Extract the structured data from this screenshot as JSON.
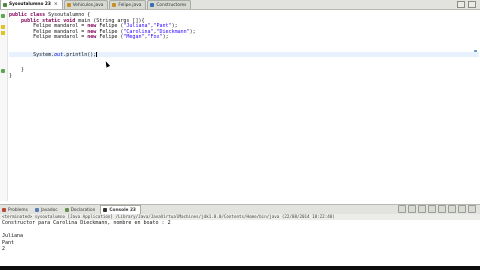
{
  "editor_tabs": [
    {
      "label": "Sysoutalumno 23",
      "active": true,
      "icon_color": "#4a8a3a"
    },
    {
      "label": "Vehiculos.java",
      "active": false,
      "icon_color": "#c78f2a"
    },
    {
      "label": "Felipe.java",
      "active": false,
      "icon_color": "#c78f2a"
    },
    {
      "label": "Constructores",
      "active": false,
      "icon_color": "#3a6fb0"
    }
  ],
  "editor": {
    "line_numbers": [
      "1",
      "2",
      "3",
      "4",
      "5",
      "6",
      "7",
      "8",
      "9",
      "10",
      "11",
      "12",
      "13"
    ],
    "lines": [
      "public class Sysoutalumno {",
      "    public static void main (String args []){",
      "        Felipe mandarol = new Felipe (\"Juliana\",\"Pant\");",
      "        Felipe mandarol = new Felipe (\"Carolina\",\"Dieckmann\");",
      "        Felipe mandarol = new Felipe (\"Megan\",\"Fox\");",
      "",
      "",
      "        System.out.println();",
      "",
      "",
      "    }",
      "}",
      ""
    ]
  },
  "panel_tabs": [
    {
      "label": "Problems",
      "active": false
    },
    {
      "label": "Javadoc",
      "active": false
    },
    {
      "label": "Declaration",
      "active": false
    },
    {
      "label": "Console 23",
      "active": true
    }
  ],
  "console": {
    "header": "<terminated> sysoutalumno [Java Application] /Library/Java/JavaVirtualMachines/jdk1.8.0/Contents/Home/bin/java (22/08/2014 18:22:48)",
    "output": [
      "Constructor para Carolina Dieckmann, nombre en boato : 2",
      "",
      "Juliana",
      "Pant",
      "2"
    ]
  },
  "colors": {
    "keyword": "#7f0055",
    "string": "#2a00ff",
    "current_line": "#e8f2fe",
    "toolbar_bg": "#e2e2de"
  }
}
